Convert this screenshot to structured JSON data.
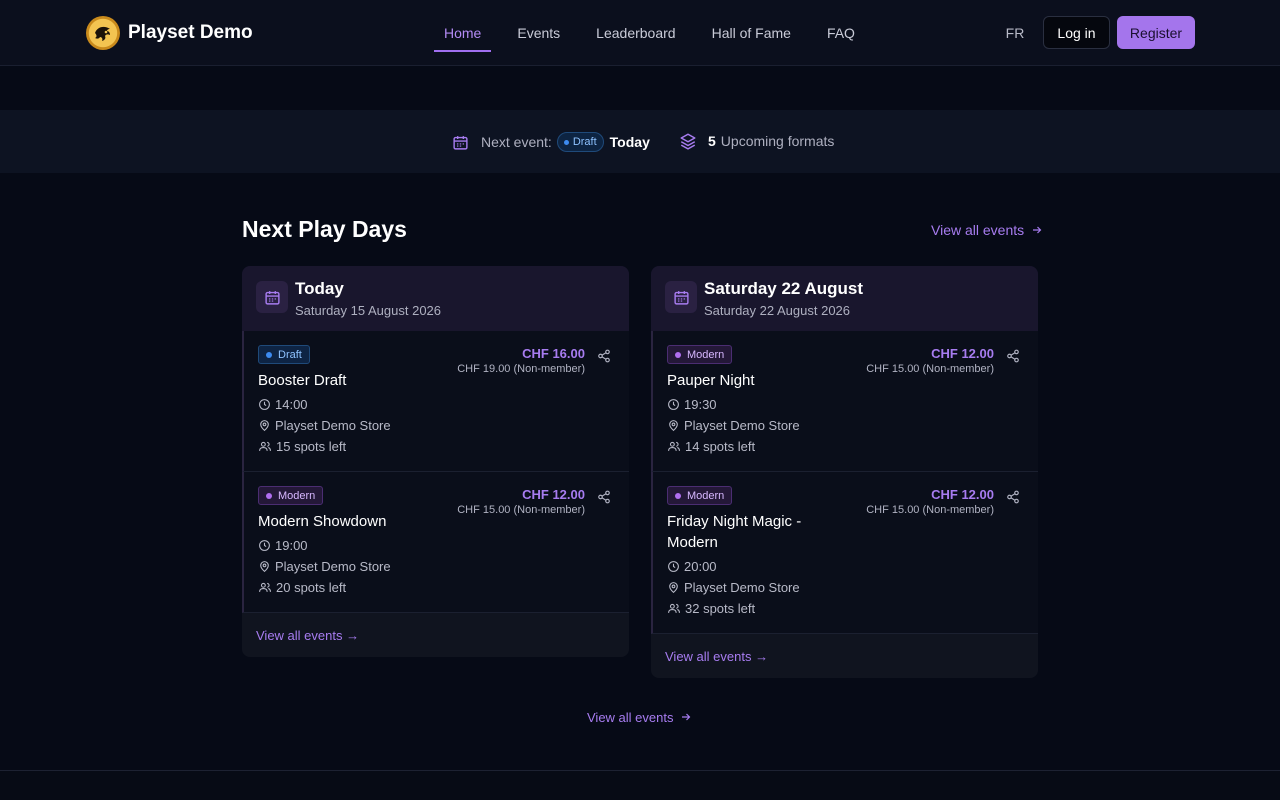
{
  "header": {
    "brand": "Playset Demo",
    "nav": [
      "Home",
      "Events",
      "Leaderboard",
      "Hall of Fame",
      "FAQ"
    ],
    "active_nav": "Home",
    "lang": "FR",
    "login": "Log in",
    "register": "Register"
  },
  "band": {
    "next_label": "Next event:",
    "next_badge": "Draft",
    "next_when": "Today",
    "formats_count": "5",
    "formats_label": "Upcoming formats"
  },
  "section": {
    "title": "Next Play Days",
    "view_all": "View all events",
    "view_all_bottom": "View all events"
  },
  "days": [
    {
      "title": "Today",
      "date": "Saturday 15 August 2026",
      "footer": "View all events →",
      "events": [
        {
          "tag": "Draft",
          "name": "Booster Draft",
          "price": "CHF 16.00",
          "price_non_member": "CHF 19.00 (Non-member)",
          "time": "14:00",
          "location": "Playset Demo Store",
          "spots": "15 spots left"
        },
        {
          "tag": "Modern",
          "name": "Modern Showdown",
          "price": "CHF 12.00",
          "price_non_member": "CHF 15.00 (Non-member)",
          "time": "19:00",
          "location": "Playset Demo Store",
          "spots": "20 spots left"
        }
      ]
    },
    {
      "title": "Saturday 22 August",
      "date": "Saturday 22 August 2026",
      "footer": "View all events →",
      "events": [
        {
          "tag": "Modern",
          "name": "Pauper Night",
          "price": "CHF 12.00",
          "price_non_member": "CHF 15.00 (Non-member)",
          "time": "19:30",
          "location": "Playset Demo Store",
          "spots": "14 spots left"
        },
        {
          "tag": "Modern",
          "name": "Friday Night Magic - Modern",
          "price": "CHF 12.00",
          "price_non_member": "CHF 15.00 (Non-member)",
          "time": "20:00",
          "location": "Playset Demo Store",
          "spots": "32 spots left"
        }
      ]
    }
  ],
  "colors": {
    "accent": "#a475ec",
    "background": "#060a16",
    "draft_blue": "#3d8bf0"
  }
}
